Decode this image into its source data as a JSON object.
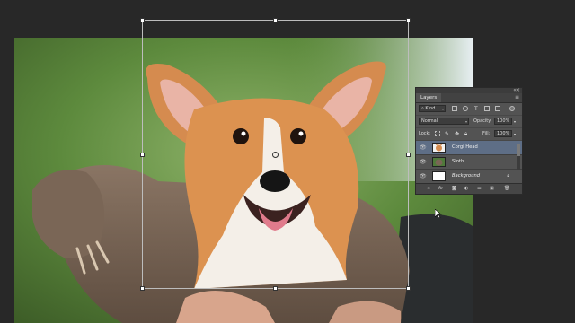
{
  "panel": {
    "tab_label": "Layers",
    "kind_filter": "Kind",
    "blend_mode": "Normal",
    "opacity_label": "Opacity:",
    "opacity_value": "100%",
    "lock_label": "Lock:",
    "fill_label": "Fill:",
    "fill_value": "100%",
    "layers": [
      {
        "name": "Corgi Head",
        "selected": true,
        "visible": true
      },
      {
        "name": "Sloth",
        "selected": false,
        "visible": true
      },
      {
        "name": "Background",
        "selected": false,
        "visible": true,
        "locked": true
      }
    ],
    "bottom_icons": [
      "link-icon",
      "fx-icon",
      "mask-icon",
      "adjustment-icon",
      "folder-icon",
      "new-layer-icon",
      "trash-icon"
    ]
  },
  "colors": {
    "workspace": "#282828",
    "panel": "#535353",
    "selected_layer": "#5e6e86"
  }
}
